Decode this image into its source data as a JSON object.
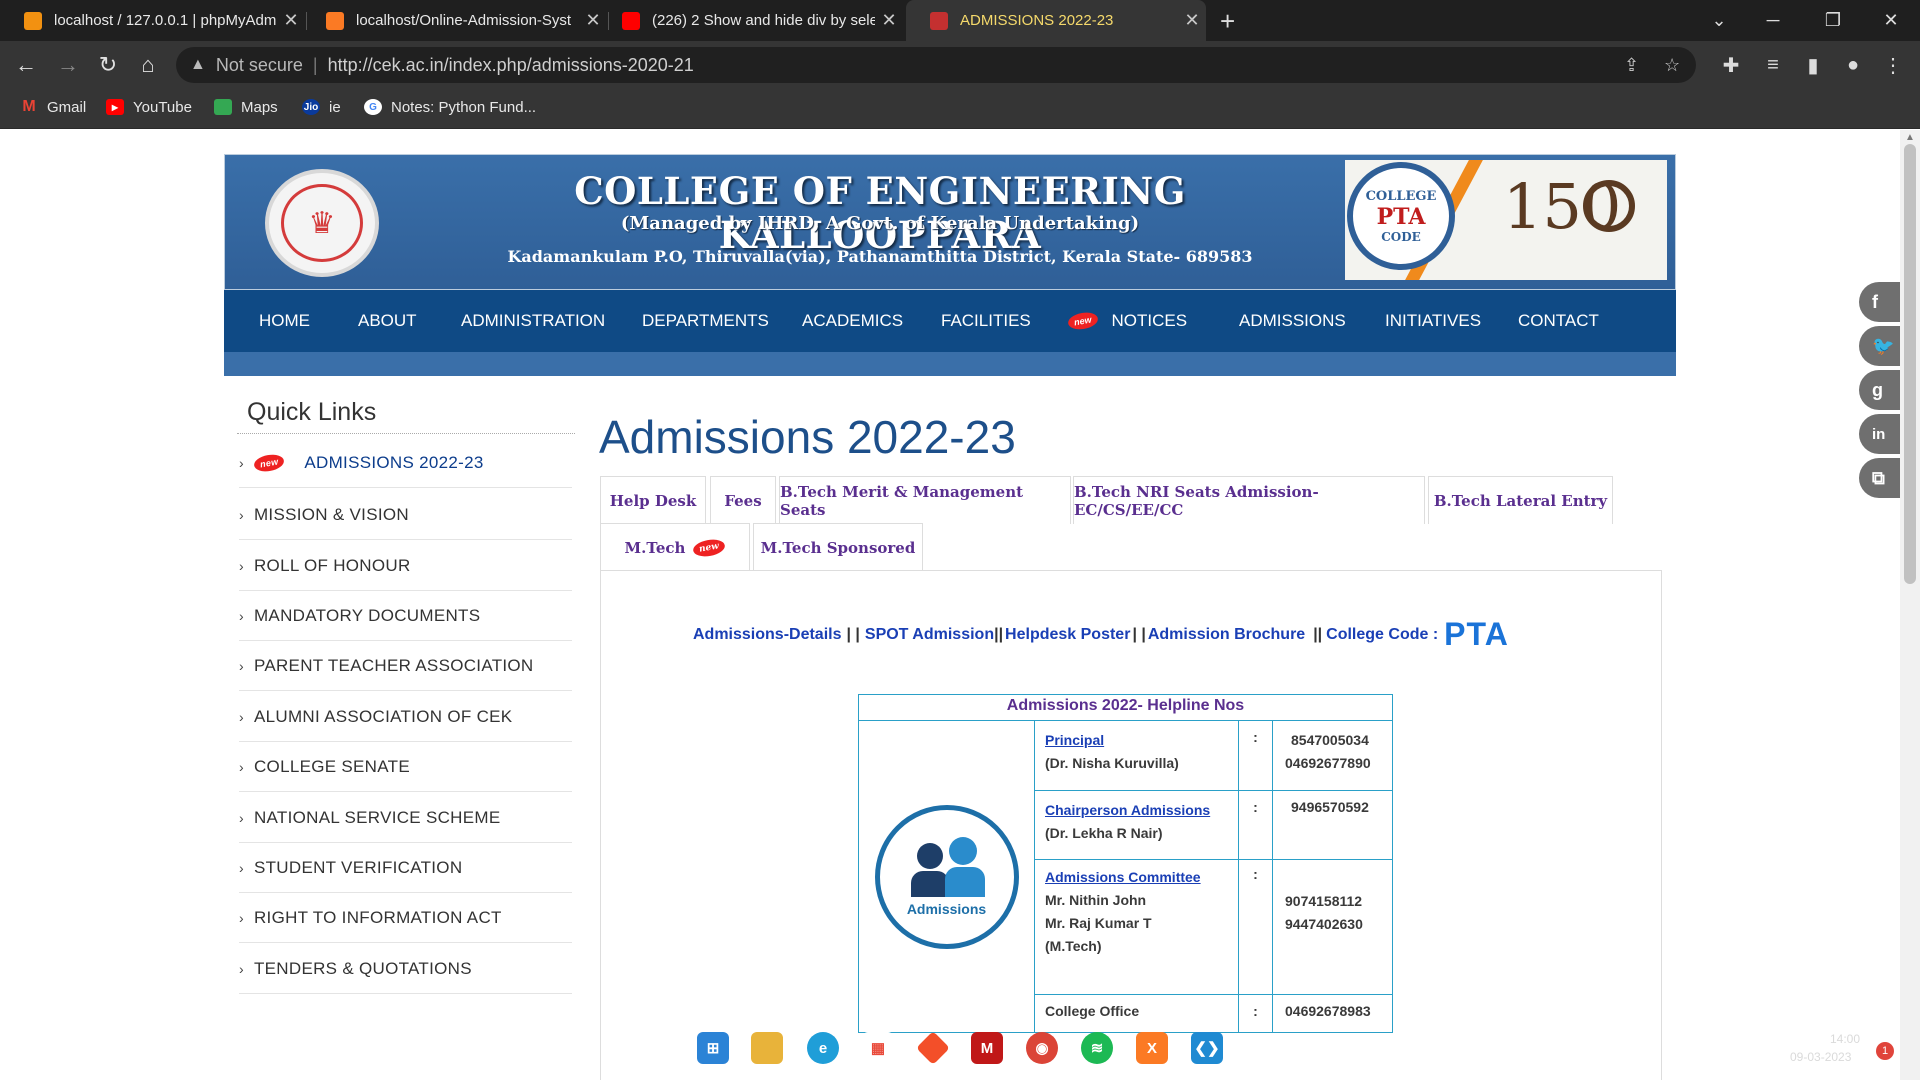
{
  "browser": {
    "tabs": [
      {
        "title": "localhost / 127.0.0.1 | phpMyAdm",
        "icon": "phpmyadmin-icon",
        "color": "#f29111"
      },
      {
        "title": "localhost/Online-Admission-Syst",
        "icon": "xampp-icon",
        "color": "#fb7a24"
      },
      {
        "title": "(226) 2 Show and hide div by sele",
        "icon": "youtube-icon",
        "color": "#ff0000"
      },
      {
        "title": "ADMISSIONS 2022-23",
        "icon": "college-icon",
        "color": "#c43030"
      }
    ],
    "address": {
      "security": "Not secure",
      "url": "http://cek.ac.in/index.php/admissions-2020-21"
    },
    "bookmarks": [
      {
        "label": "Gmail",
        "icon": "gmail-icon",
        "color": "#ea4335"
      },
      {
        "label": "YouTube",
        "icon": "youtube-icon",
        "color": "#ff0000"
      },
      {
        "label": "Maps",
        "icon": "maps-icon",
        "color": "#34a853"
      },
      {
        "label": "ie",
        "icon": "jio-icon",
        "color": "#0a3a9c"
      },
      {
        "label": "Notes: Python Fund...",
        "icon": "google-icon",
        "color": "#ffffff"
      }
    ]
  },
  "banner": {
    "title": "COLLEGE OF ENGINEERING KALLOOPPARA",
    "subtitle": "(Managed by IHRD, A Govt. of Kerala Undertaking)",
    "address": "Kadamankulam P.O, Thiruvalla(via), Pathanamthitta District, Kerala State- 689583",
    "badge_top": "COLLEGE",
    "badge_code": "PTA",
    "badge_bottom": "CODE",
    "anniversary": "150"
  },
  "nav": {
    "items": [
      "HOME",
      "ABOUT",
      "ADMINISTRATION",
      "DEPARTMENTS",
      "ACADEMICS",
      "FACILITIES",
      "NOTICES",
      "ADMISSIONS",
      "INITIATIVES",
      "CONTACT"
    ],
    "new_badge": "new"
  },
  "sidebar": {
    "title": "Quick Links",
    "items": [
      "ADMISSIONS 2022-23",
      "MISSION & VISION",
      "ROLL OF HONOUR",
      "MANDATORY DOCUMENTS",
      "PARENT TEACHER ASSOCIATION",
      "ALUMNI ASSOCIATION OF CEK",
      "COLLEGE SENATE",
      "NATIONAL SERVICE SCHEME",
      "STUDENT VERIFICATION",
      "RIGHT TO INFORMATION ACT",
      "TENDERS & QUOTATIONS"
    ]
  },
  "main": {
    "heading": "Admissions 2022-23",
    "tabs": [
      "Help Desk",
      "Fees",
      "B.Tech Merit & Management Seats",
      "B.Tech NRI Seats Admission-EC/CS/EE/CC",
      "B.Tech Lateral Entry",
      "M.Tech",
      "M.Tech Sponsored"
    ],
    "links": {
      "details": "Admissions-Details",
      "sep1": "| |",
      "spot": "SPOT Admission",
      "sep2": "||",
      "poster": "Helpdesk Poster",
      "sep3": "| |",
      "brochure": "Admission Brochure",
      "sep4": "||",
      "code_label": "College Code :",
      "code_value": "PTA"
    },
    "helpline": {
      "title": "Admissions 2022- Helpline Nos",
      "logo_label": "Admissions",
      "rows": [
        {
          "role": "Principal",
          "names": [
            "(Dr. Nisha Kuruvilla)"
          ],
          "colon": ":",
          "numbers": [
            "8547005034",
            "04692677890"
          ]
        },
        {
          "role": "Chairperson Admissions",
          "names": [
            "(Dr. Lekha R Nair)"
          ],
          "colon": ":",
          "numbers": [
            "9496570592"
          ]
        },
        {
          "role": "Admissions Committee",
          "names": [
            "Mr. Nithin John",
            "Mr. Raj Kumar T",
            "(M.Tech)"
          ],
          "colon": ":",
          "numbers": [
            "9074158112",
            "9447402630"
          ]
        },
        {
          "role": "",
          "names": [
            "College Office"
          ],
          "colon": ":",
          "numbers": [
            "04692678983"
          ]
        }
      ]
    }
  },
  "social": [
    "f",
    "twitter",
    "g",
    "in",
    "share"
  ],
  "taskbar": {
    "icons": [
      "windows-start-icon",
      "file-explorer-icon",
      "edge-icon",
      "store-icon",
      "git-icon",
      "mcafee-icon",
      "chrome-icon",
      "spotify-icon",
      "xampp-icon",
      "vscode-icon"
    ],
    "time": "14:00",
    "date": "09-03-2023",
    "notifications": "1"
  }
}
